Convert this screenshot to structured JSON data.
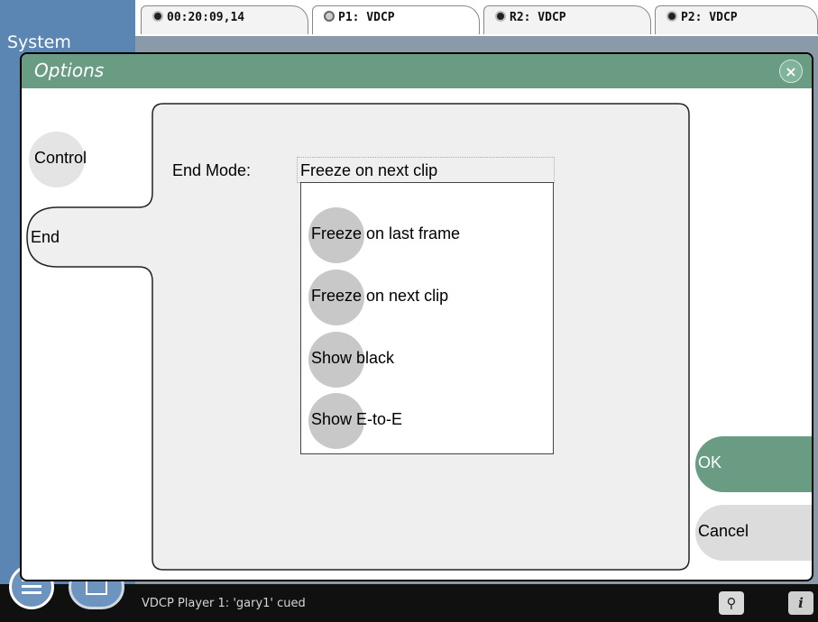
{
  "window": {
    "sidebar_partial_label": "System"
  },
  "tabs": [
    {
      "label": "00:20:09,14",
      "active": false
    },
    {
      "label": "P1: VDCP",
      "active": true
    },
    {
      "label": "R2: VDCP",
      "active": false
    },
    {
      "label": "P2: VDCP",
      "active": false
    }
  ],
  "dialog": {
    "title": "Options",
    "close_glyph": "×",
    "nav": {
      "control_label": "Control",
      "end_label": "End"
    },
    "end_mode": {
      "label": "End Mode:",
      "value": "Freeze on next clip",
      "options": [
        "Freeze on last frame",
        "Freeze on next clip",
        "Show black",
        "Show E-to-E"
      ]
    },
    "buttons": {
      "ok": "OK",
      "cancel": "Cancel"
    }
  },
  "statusbar": {
    "message": "VDCP Player 1: 'gary1' cued",
    "icons": [
      "connection-icon",
      "info-icon"
    ],
    "info_glyph": "i"
  },
  "colors": {
    "accent_green": "#6a9c84",
    "app_blue": "#5b86b3"
  }
}
